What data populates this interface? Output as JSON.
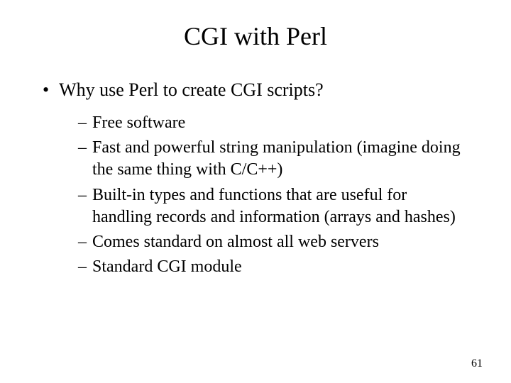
{
  "title": "CGI with Perl",
  "bullet1": {
    "marker": "•",
    "text": "Why use Perl to create CGI scripts?"
  },
  "sub": {
    "dash": "–",
    "items": [
      "Free software",
      "Fast and powerful string manipulation (imagine doing the same thing with C/C++)",
      "Built-in types and functions that are useful for handling records and information (arrays and hashes)",
      "Comes standard on almost all web servers",
      "Standard CGI module"
    ]
  },
  "page_number": "61"
}
